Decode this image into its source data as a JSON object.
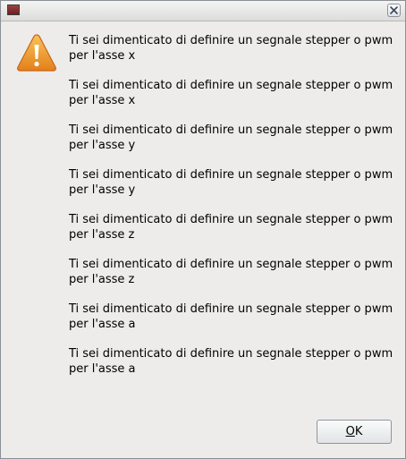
{
  "window": {
    "close_icon": "close-icon",
    "window_icon": "window-icon"
  },
  "dialog": {
    "icon": "warning-icon",
    "messages": [
      {
        "line1": "Ti sei dimenticato di definire un segnale stepper o pwm",
        "line2": "per l'asse x"
      },
      {
        "line1": "Ti sei dimenticato di definire un segnale stepper o pwm",
        "line2": "per l'asse x"
      },
      {
        "line1": "Ti sei dimenticato di definire un segnale stepper o pwm",
        "line2": "per l'asse y"
      },
      {
        "line1": "Ti sei dimenticato di definire un segnale stepper o pwm",
        "line2": "per l'asse y"
      },
      {
        "line1": "Ti sei dimenticato di definire un segnale stepper o pwm",
        "line2": "per l'asse z"
      },
      {
        "line1": "Ti sei dimenticato di definire un segnale stepper o pwm",
        "line2": "per l'asse z"
      },
      {
        "line1": "Ti sei dimenticato di definire un segnale stepper o pwm",
        "line2": "per l'asse a"
      },
      {
        "line1": "Ti sei dimenticato di definire un segnale stepper o pwm",
        "line2": "per l'asse a"
      }
    ],
    "ok_mnemonic": "O",
    "ok_rest": "K"
  },
  "colors": {
    "background": "#edeceb",
    "warning_fill": "#f0a030"
  }
}
